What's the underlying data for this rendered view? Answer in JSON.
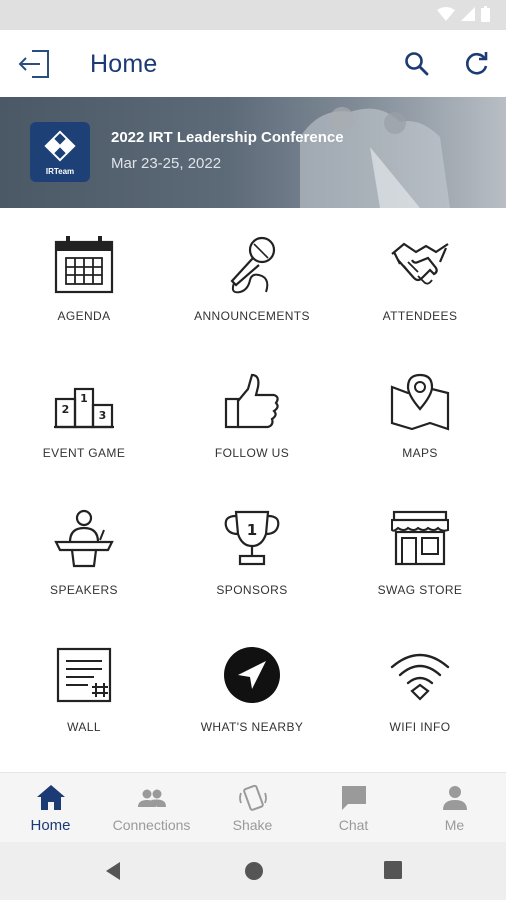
{
  "header": {
    "title": "Home"
  },
  "banner": {
    "event_title": "2022 IRT Leadership Conference",
    "event_dates": "Mar 23-25, 2022",
    "logo_text": "IRTeam"
  },
  "menu": {
    "items": [
      {
        "label": "AGENDA",
        "icon": "calendar-icon"
      },
      {
        "label": "ANNOUNCEMENTS",
        "icon": "microphone-icon"
      },
      {
        "label": "ATTENDEES",
        "icon": "handshake-icon"
      },
      {
        "label": "EVENT GAME",
        "icon": "podium-icon"
      },
      {
        "label": "FOLLOW US",
        "icon": "thumbs-up-icon"
      },
      {
        "label": "MAPS",
        "icon": "map-pin-icon"
      },
      {
        "label": "SPEAKERS",
        "icon": "speaker-podium-icon"
      },
      {
        "label": "SPONSORS",
        "icon": "trophy-icon"
      },
      {
        "label": "SWAG STORE",
        "icon": "storefront-icon"
      },
      {
        "label": "WALL",
        "icon": "wall-post-icon"
      },
      {
        "label": "WHAT'S NEARBY",
        "icon": "navigation-arrow-icon"
      },
      {
        "label": "WIFI INFO",
        "icon": "wifi-icon"
      }
    ]
  },
  "bottom_nav": {
    "items": [
      {
        "label": "Home",
        "active": true,
        "icon": "home-icon"
      },
      {
        "label": "Connections",
        "active": false,
        "icon": "people-icon"
      },
      {
        "label": "Shake",
        "active": false,
        "icon": "shake-phone-icon"
      },
      {
        "label": "Chat",
        "active": false,
        "icon": "chat-icon"
      },
      {
        "label": "Me",
        "active": false,
        "icon": "person-icon"
      }
    ]
  },
  "colors": {
    "accent": "#1c3a73",
    "inactive": "#9a9a9a"
  }
}
